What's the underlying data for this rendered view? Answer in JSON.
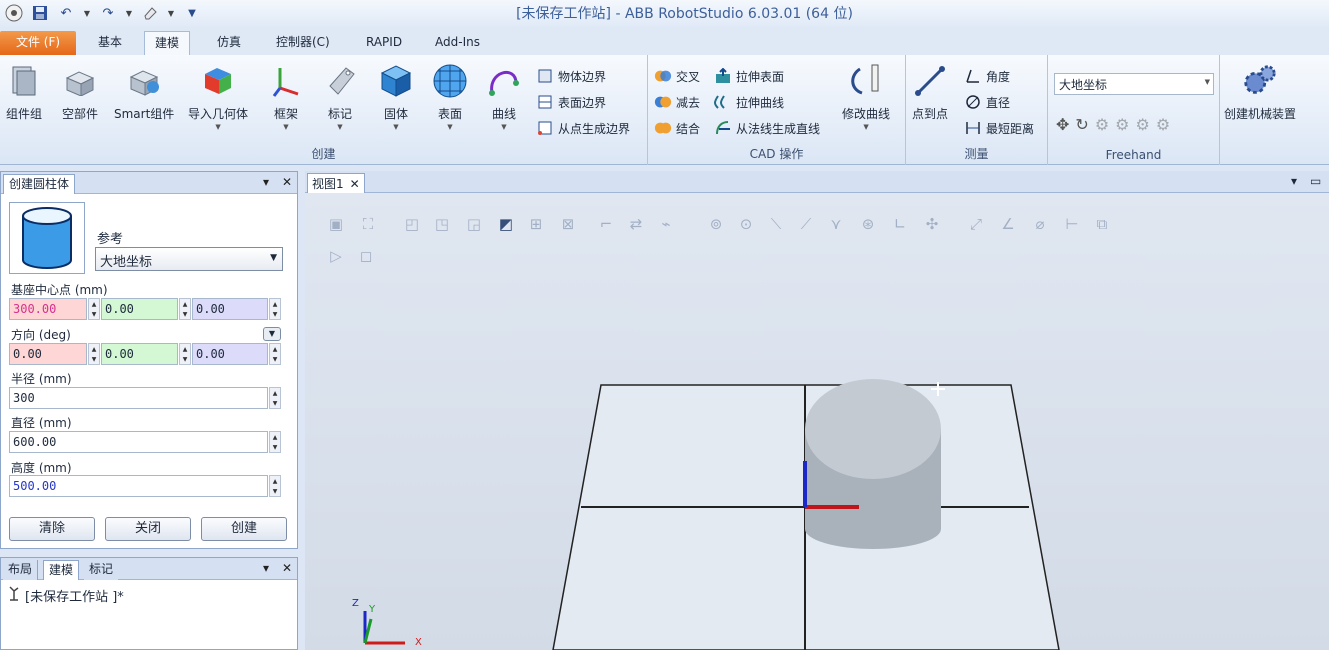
{
  "window": {
    "title": "[未保存工作站] - ABB  RobotStudio  6.03.01  (64 位)"
  },
  "quick_access": {
    "icons": [
      "app-logo-icon",
      "save-icon",
      "undo-icon",
      "redo-icon",
      "eraser-icon",
      "customize-icon"
    ]
  },
  "tabs": [
    {
      "label": "文件 (F)"
    },
    {
      "label": "基本"
    },
    {
      "label": "建模"
    },
    {
      "label": "仿真"
    },
    {
      "label": "控制器(C)"
    },
    {
      "label": "RAPID"
    },
    {
      "label": "Add-Ins"
    }
  ],
  "active_tab": "建模",
  "ribbon": {
    "create": {
      "label": "创建",
      "buttons": [
        "组件组",
        "空部件",
        "Smart组件",
        "导入几何体",
        "框架",
        "标记",
        "固体",
        "表面",
        "曲线"
      ],
      "small": [
        "物体边界",
        "表面边界",
        "从点生成边界"
      ]
    },
    "cad": {
      "label": "CAD 操作",
      "small": [
        "交叉",
        "减去",
        "结合",
        "拉伸表面",
        "拉伸曲线",
        "从法线生成直线"
      ],
      "modify": "修改曲线"
    },
    "measure": {
      "label": "测量",
      "point": "点到点",
      "small": [
        "角度",
        "直径",
        "最短距离"
      ]
    },
    "freehand": {
      "label": "Freehand",
      "coord": "大地坐标"
    },
    "mechanism": {
      "label": "创建机械装置"
    }
  },
  "cyl_panel": {
    "title": "创建圆柱体",
    "ref_label": "参考",
    "ref_value": "大地坐标",
    "base_label": "基座中心点 (mm)",
    "base": [
      "300.00",
      "0.00",
      "0.00"
    ],
    "dir_label": "方向 (deg)",
    "dir": [
      "0.00",
      "0.00",
      "0.00"
    ],
    "radius_label": "半径 (mm)",
    "radius": "300",
    "diameter_label": "直径 (mm)",
    "diameter": "600.00",
    "height_label": "高度 (mm)",
    "height": "500.00",
    "clear": "清除",
    "close": "关闭",
    "create": "创建",
    "colors": {
      "x": "#ffd6d6",
      "y": "#d4f7d4",
      "z": "#dcdcfa"
    }
  },
  "tree_panel": {
    "tabs": [
      "布局",
      "建模",
      "标记"
    ],
    "active_tab": "建模",
    "root": "[未保存工作站 ]*"
  },
  "view": {
    "tab": "视图1",
    "axes": [
      "Z",
      "Y",
      "X"
    ]
  }
}
